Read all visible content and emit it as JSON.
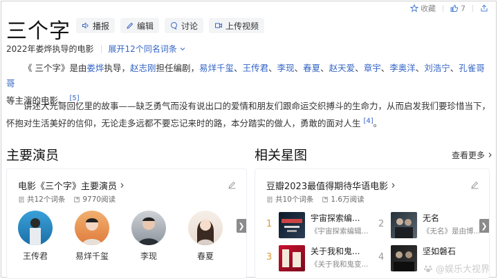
{
  "top_actions": {
    "collect": "收藏",
    "like_count": "7"
  },
  "title": "三个字",
  "tools": [
    {
      "label": "播报"
    },
    {
      "label": "编辑"
    },
    {
      "label": "讨论"
    },
    {
      "label": "上传视频"
    }
  ],
  "subtitle": {
    "desc": "2022年娄烨执导的电影",
    "expand": "展开12个同名词条"
  },
  "para1": {
    "t1": "《 三个字》是由",
    "director": "娄烨",
    "t2": "执导，",
    "writer": "赵志刚",
    "t3": "担任编剧，",
    "a1": "易烊千玺",
    "a2": "王传君",
    "a3": "李现",
    "a4": "春夏",
    "a5": "赵天爱",
    "a6": "章宇",
    "a7": "李奥洋",
    "a8": "刘浩宁",
    "a9": "孔雀哥哥",
    "sep": "、",
    "t4": "等主演的电影。",
    "ref": "[5]"
  },
  "para2": {
    "text": "讲述大光哥回忆里的故事——缺乏勇气而没有说出口的爱情和朋友们跟命运交织搏斗的生命力，从而启发我们要珍惜当下，怀抱对生活美好的信仰，无论走多远都不要忘记来时的路，本分踏实的做人，勇敢的面对人生",
    "ref": "[4]",
    "end": "。"
  },
  "cast_section": {
    "title": "主要演员",
    "card_title": "电影《三个字》主要演员",
    "entries": "共12个词条",
    "reads": "9770阅读",
    "actors": [
      {
        "name": "王传君"
      },
      {
        "name": "易烊千玺"
      },
      {
        "name": "李现"
      },
      {
        "name": "春夏"
      }
    ]
  },
  "star_section": {
    "title": "相关星图",
    "more": "查看更多",
    "card_title": "豆瓣2023最值得期待华语电影",
    "entries": "共10个词条",
    "reads": "1.6万阅读",
    "items": [
      {
        "rank": "1",
        "title": "宇宙探索编...",
        "sub": "《宇宙探索编辑..."
      },
      {
        "rank": "2",
        "title": "无名",
        "sub": "《无名》是由博..."
      },
      {
        "rank": "3",
        "title": "关于我和鬼...",
        "sub": "《关于我和鬼变..."
      },
      {
        "rank": "4",
        "title": "坚如磐石",
        "sub": ""
      }
    ]
  },
  "watermark": "@娱乐大视界",
  "colors": {
    "link": "#3465c5",
    "rank_gold": "#d89a3a"
  }
}
